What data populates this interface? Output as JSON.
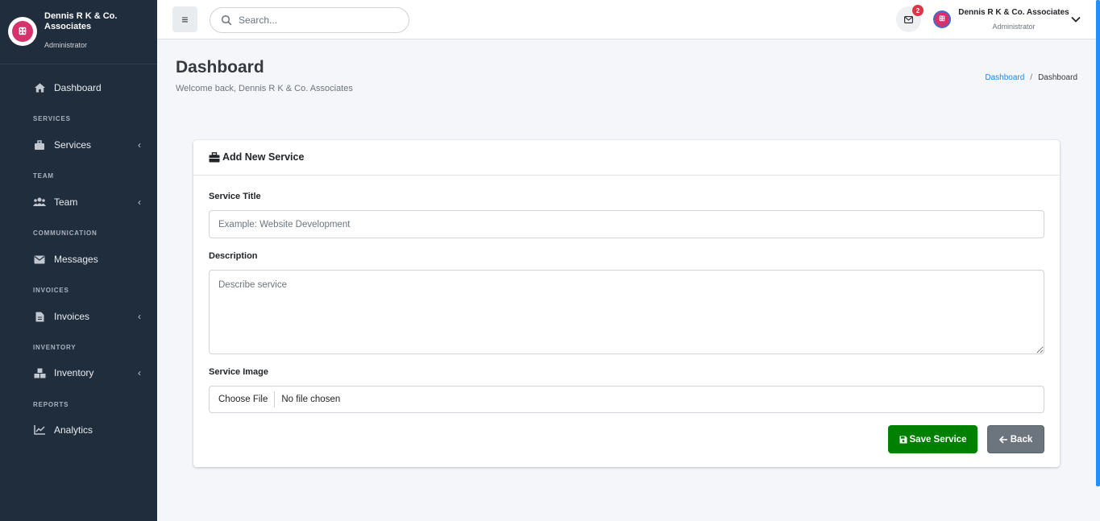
{
  "brand": {
    "name": "Dennis R K & Co. Associates",
    "role": "Administrator",
    "logo_glyph": "ꕥ"
  },
  "sidebar": {
    "items": [
      {
        "label": "Dashboard",
        "icon": "home-icon"
      },
      {
        "header": "SERVICES",
        "label": "Services",
        "icon": "briefcase-icon",
        "has_submenu": true
      },
      {
        "header": "TEAM",
        "label": "Team",
        "icon": "users-icon",
        "has_submenu": true
      },
      {
        "header": "COMMUNICATION",
        "label": "Messages",
        "icon": "envelope-icon"
      },
      {
        "header": "INVOICES",
        "label": "Invoices",
        "icon": "file-icon",
        "has_submenu": true
      },
      {
        "header": "INVENTORY",
        "label": "Inventory",
        "icon": "boxes-icon",
        "has_submenu": true
      },
      {
        "header": "REPORTS",
        "label": "Analytics",
        "icon": "chart-line-icon"
      }
    ],
    "chevron": "‹"
  },
  "topbar": {
    "menu_icon": "≡",
    "search_placeholder": "Search...",
    "notification_count": "2",
    "user_name": "Dennis R K & Co. Associates",
    "user_role": "Administrator"
  },
  "page": {
    "title": "Dashboard",
    "subtitle": "Welcome back, Dennis R K & Co. Associates",
    "breadcrumb": [
      "Dashboard",
      "Dashboard"
    ],
    "breadcrumb_sep": "/"
  },
  "form": {
    "title": "Add New Service",
    "service_title_label": "Service Title",
    "service_title_placeholder": "Example: Website Development",
    "description_label": "Description",
    "description_placeholder": "Describe service",
    "image_label": "Service Image",
    "choose_file_label": "Choose File",
    "no_file_text": "No file chosen",
    "save_label": "Save Service",
    "back_label": "Back"
  },
  "colors": {
    "sidebar_bg": "#1f2d3d",
    "save_green": "#008000",
    "back_gray": "#6c757d",
    "badge_red": "#dc3545",
    "link_blue": "#1e88e5"
  }
}
